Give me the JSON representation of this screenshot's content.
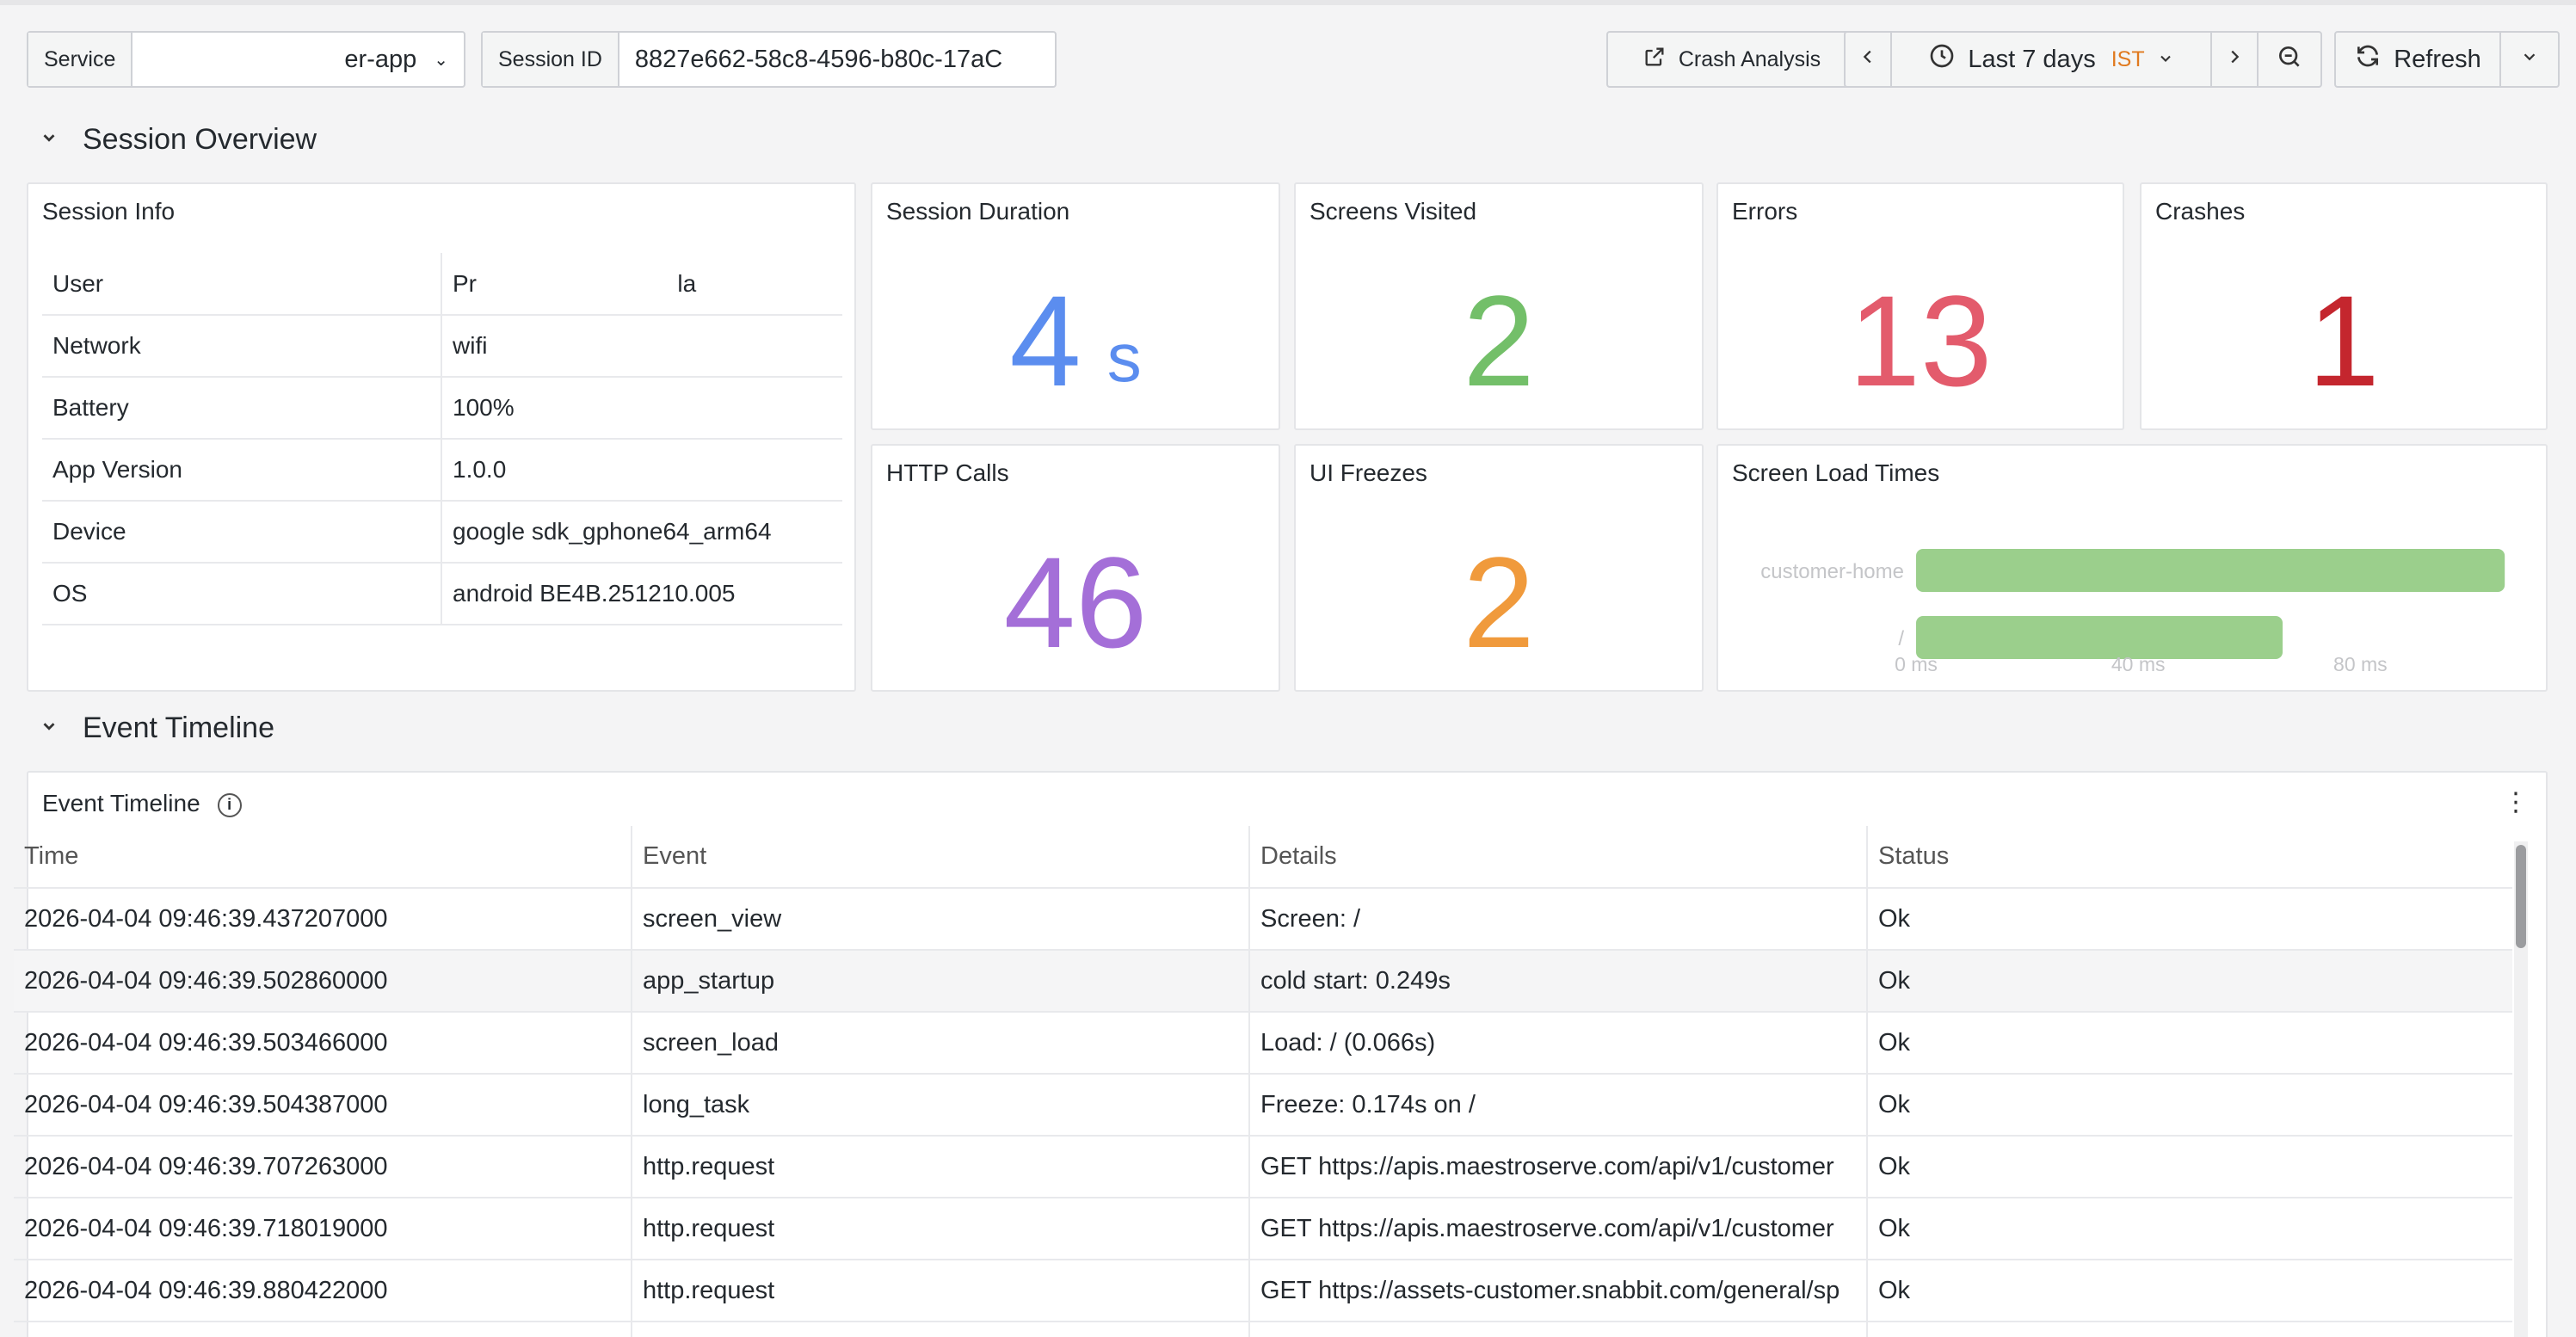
{
  "toolbar": {
    "service_label": "Service",
    "service_value": "er-app",
    "session_label": "Session ID",
    "session_value": "8827e662-58c8-4596-b80c-17aC",
    "crash_analysis": "Crash Analysis",
    "time_range": "Last 7 days",
    "timezone": "IST",
    "refresh": "Refresh"
  },
  "sections": {
    "overview": "Session Overview",
    "timeline": "Event Timeline"
  },
  "session_info": {
    "title": "Session Info",
    "rows": [
      {
        "key": "User",
        "value": "Pr                              la"
      },
      {
        "key": "Network",
        "value": "wifi"
      },
      {
        "key": "Battery",
        "value": "100%"
      },
      {
        "key": "App Version",
        "value": "1.0.0"
      },
      {
        "key": "Device",
        "value": "google sdk_gphone64_arm64"
      },
      {
        "key": "OS",
        "value": "android BE4B.251210.005"
      }
    ]
  },
  "stats": {
    "duration": {
      "title": "Session Duration",
      "value": "4",
      "unit": "s",
      "color": "#5b8def"
    },
    "screens": {
      "title": "Screens Visited",
      "value": "2",
      "color": "#73bf69"
    },
    "errors": {
      "title": "Errors",
      "value": "13",
      "color": "#e35b6c"
    },
    "crashes": {
      "title": "Crashes",
      "value": "1",
      "color": "#c4262e"
    },
    "http": {
      "title": "HTTP Calls",
      "value": "46",
      "color": "#a46fd8"
    },
    "freezes": {
      "title": "UI Freezes",
      "value": "2",
      "color": "#f09a3c"
    }
  },
  "chart_data": {
    "type": "bar",
    "title": "Screen Load Times",
    "orientation": "horizontal",
    "categories": [
      "customer-home",
      "/"
    ],
    "values": [
      106,
      66
    ],
    "xlim": [
      0,
      110
    ],
    "xticks": [
      "0 ms",
      "40 ms",
      "80 ms"
    ],
    "xtick_values": [
      0,
      40,
      80
    ],
    "color": "#9bcf8c"
  },
  "timeline": {
    "title": "Event Timeline",
    "columns": [
      "Time",
      "Event",
      "Details",
      "Status"
    ],
    "rows": [
      {
        "time": "2026-04-04 09:46:39.437207000",
        "event": "screen_view",
        "details": "Screen: /",
        "status": "Ok"
      },
      {
        "time": "2026-04-04 09:46:39.502860000",
        "event": "app_startup",
        "details": "cold start: 0.249s",
        "status": "Ok"
      },
      {
        "time": "2026-04-04 09:46:39.503466000",
        "event": "screen_load",
        "details": "Load: / (0.066s)",
        "status": "Ok"
      },
      {
        "time": "2026-04-04 09:46:39.504387000",
        "event": "long_task",
        "details": "Freeze: 0.174s on /",
        "status": "Ok"
      },
      {
        "time": "2026-04-04 09:46:39.707263000",
        "event": "http.request",
        "details": "GET https://apis.maestroserve.com/api/v1/customer",
        "status": "Ok"
      },
      {
        "time": "2026-04-04 09:46:39.718019000",
        "event": "http.request",
        "details": "GET https://apis.maestroserve.com/api/v1/customer",
        "status": "Ok"
      },
      {
        "time": "2026-04-04 09:46:39.880422000",
        "event": "http.request",
        "details": "GET https://assets-customer.snabbit.com/general/sp",
        "status": "Ok"
      },
      {
        "time": "",
        "event": "",
        "details": "",
        "status": ""
      }
    ]
  }
}
